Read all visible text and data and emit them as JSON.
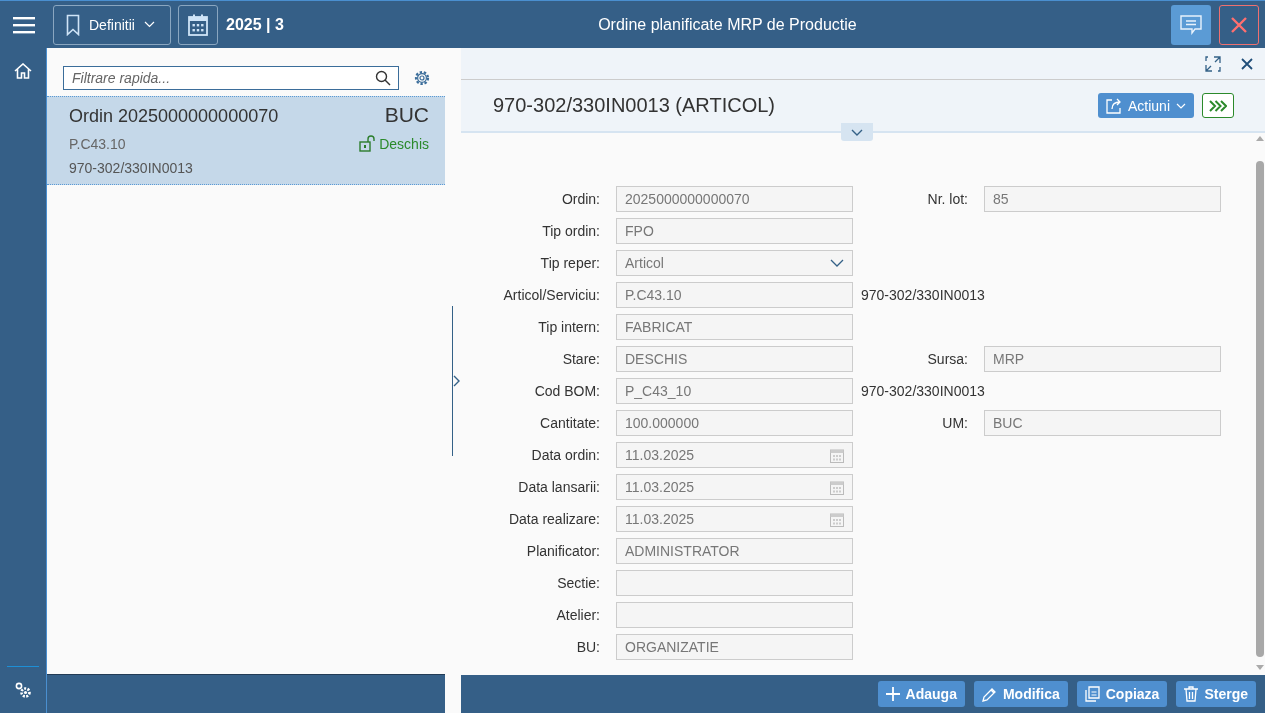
{
  "header": {
    "bookmark_button": "Definitii",
    "period": "2025 | 3",
    "title": "Ordine planificate MRP de Productie"
  },
  "list": {
    "filter": {
      "placeholder": "Filtrare rapida..."
    },
    "items": [
      {
        "title": "Ordin 2025000000000070",
        "unit": "BUC",
        "code": "P.C43.10",
        "status": "Deschis",
        "description": "970-302/330IN0013",
        "selected": true
      }
    ]
  },
  "detail": {
    "title": "970-302/330IN0013 (ARTICOL)",
    "actions_button": "Actiuni",
    "rows": [
      {
        "label": "Ordin:",
        "value": "2025000000000070",
        "kind": "text",
        "second": {
          "label": "Nr. lot:",
          "value": "85"
        }
      },
      {
        "label": "Tip ordin:",
        "value": "FPO",
        "kind": "text"
      },
      {
        "label": "Tip reper:",
        "value": "Articol",
        "kind": "select"
      },
      {
        "label": "Articol/Serviciu:",
        "value": "P.C43.10",
        "kind": "text",
        "note": "970-302/330IN0013"
      },
      {
        "label": "Tip intern:",
        "value": "FABRICAT",
        "kind": "text"
      },
      {
        "label": "Stare:",
        "value": "DESCHIS",
        "kind": "text",
        "second": {
          "label": "Sursa:",
          "value": "MRP"
        }
      },
      {
        "label": "Cod BOM:",
        "value": "P_C43_10",
        "kind": "text",
        "note": "970-302/330IN0013"
      },
      {
        "label": "Cantitate:",
        "value": "100.000000",
        "kind": "text",
        "second": {
          "label": "UM:",
          "value": "BUC"
        }
      },
      {
        "label": "Data ordin:",
        "value": "11.03.2025",
        "kind": "date"
      },
      {
        "label": "Data lansarii:",
        "value": "11.03.2025",
        "kind": "date"
      },
      {
        "label": "Data realizare:",
        "value": "11.03.2025",
        "kind": "date"
      },
      {
        "label": "Planificator:",
        "value": "ADMINISTRATOR",
        "kind": "text"
      },
      {
        "label": "Sectie:",
        "kind": "text"
      },
      {
        "label": "Atelier:",
        "kind": "text"
      },
      {
        "label": "BU:",
        "value": "ORGANIZATIE",
        "kind": "text"
      }
    ],
    "footer_buttons": [
      {
        "label": "Adauga",
        "kind": "add"
      },
      {
        "label": "Modifica",
        "kind": "edit"
      },
      {
        "label": "Copiaza",
        "kind": "copy"
      },
      {
        "label": "Sterge",
        "kind": "delete"
      }
    ]
  }
}
